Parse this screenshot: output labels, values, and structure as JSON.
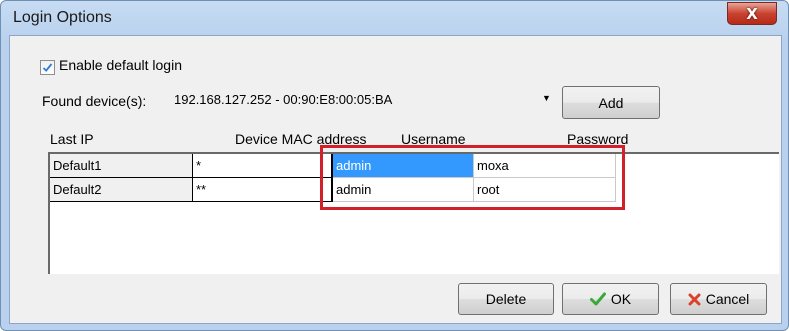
{
  "window": {
    "title": "Login Options",
    "close_label": "X"
  },
  "enable_default_login": {
    "label": "Enable default login",
    "checked": true
  },
  "found_devices": {
    "label": "Found device(s):",
    "selected": "192.168.127.252 - 00:90:E8:00:05:BA"
  },
  "buttons": {
    "add": "Add",
    "delete": "Delete",
    "ok": "OK",
    "cancel": "Cancel"
  },
  "table": {
    "columns": [
      "Last IP",
      "Device MAC address",
      "Username",
      "Password"
    ],
    "rows": [
      {
        "last_ip": "Default1",
        "mac": "*",
        "username": "admin",
        "password": "moxa",
        "selected_cell": "username"
      },
      {
        "last_ip": "Default2",
        "mac": "**",
        "username": "admin",
        "password": "root"
      }
    ]
  },
  "colors": {
    "selection": "#3399ff",
    "highlight_box": "#d2202a",
    "ok_check": "#3aa93a",
    "cancel_x": "#d9432b",
    "checkbox_tick": "#2b7bd6"
  },
  "icons": {
    "checkbox": "checkmark-icon",
    "combo": "dropdown-arrow-icon",
    "ok": "green-checkmark-icon",
    "cancel": "red-x-icon"
  }
}
